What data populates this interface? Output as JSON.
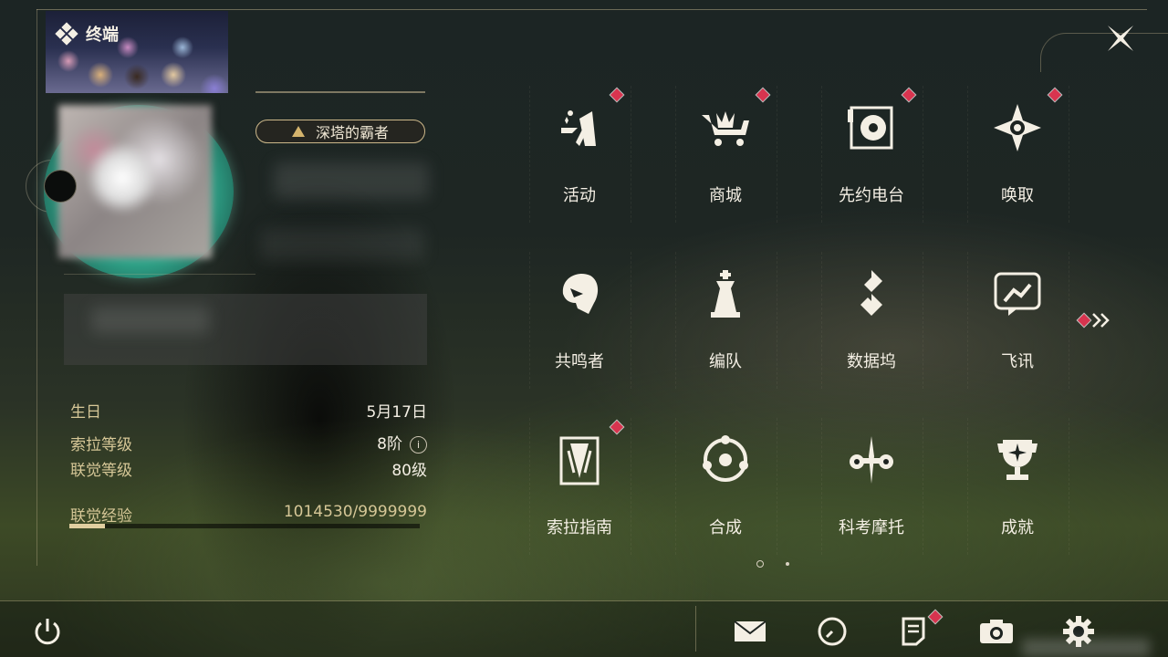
{
  "header": {
    "title": "终端"
  },
  "profile": {
    "title_badge": "深塔的霸者"
  },
  "info": {
    "birthday_label": "生日",
    "birthday_value": "5月17日",
    "rank_label": "索拉等级",
    "rank_value": "8阶",
    "rank_help": "i",
    "level_label": "联觉等级",
    "level_value": "80级",
    "exp_label": "联觉经验",
    "exp_value": "1014530/9999999",
    "exp_progress": 0.101
  },
  "menu": {
    "items": [
      {
        "label": "活动",
        "icon": "activity-icon",
        "badge": true
      },
      {
        "label": "商城",
        "icon": "shop-icon",
        "badge": true
      },
      {
        "label": "先约电台",
        "icon": "radio-icon",
        "badge": true
      },
      {
        "label": "唤取",
        "icon": "convene-icon",
        "badge": true
      },
      {
        "label": "共鸣者",
        "icon": "resonator-icon",
        "badge": false
      },
      {
        "label": "编队",
        "icon": "team-icon",
        "badge": false
      },
      {
        "label": "数据坞",
        "icon": "databank-icon",
        "badge": false
      },
      {
        "label": "飞讯",
        "icon": "message-icon",
        "badge": false
      },
      {
        "label": "索拉指南",
        "icon": "guidebook-icon",
        "badge": true
      },
      {
        "label": "合成",
        "icon": "synthesis-icon",
        "badge": false
      },
      {
        "label": "科考摩托",
        "icon": "motorbike-icon",
        "badge": false
      },
      {
        "label": "成就",
        "icon": "achievement-icon",
        "badge": false
      }
    ],
    "next_page_icon": "double-chevron-right-icon",
    "pages": 2,
    "current_page": 1
  },
  "bottom_bar": {
    "icons": [
      "power-icon",
      "mail-icon",
      "clock-icon",
      "notice-icon",
      "camera-icon",
      "settings-icon"
    ]
  },
  "colors": {
    "accent": "#d6c797",
    "badge": "#d8344f",
    "text": "#f4efe4"
  }
}
